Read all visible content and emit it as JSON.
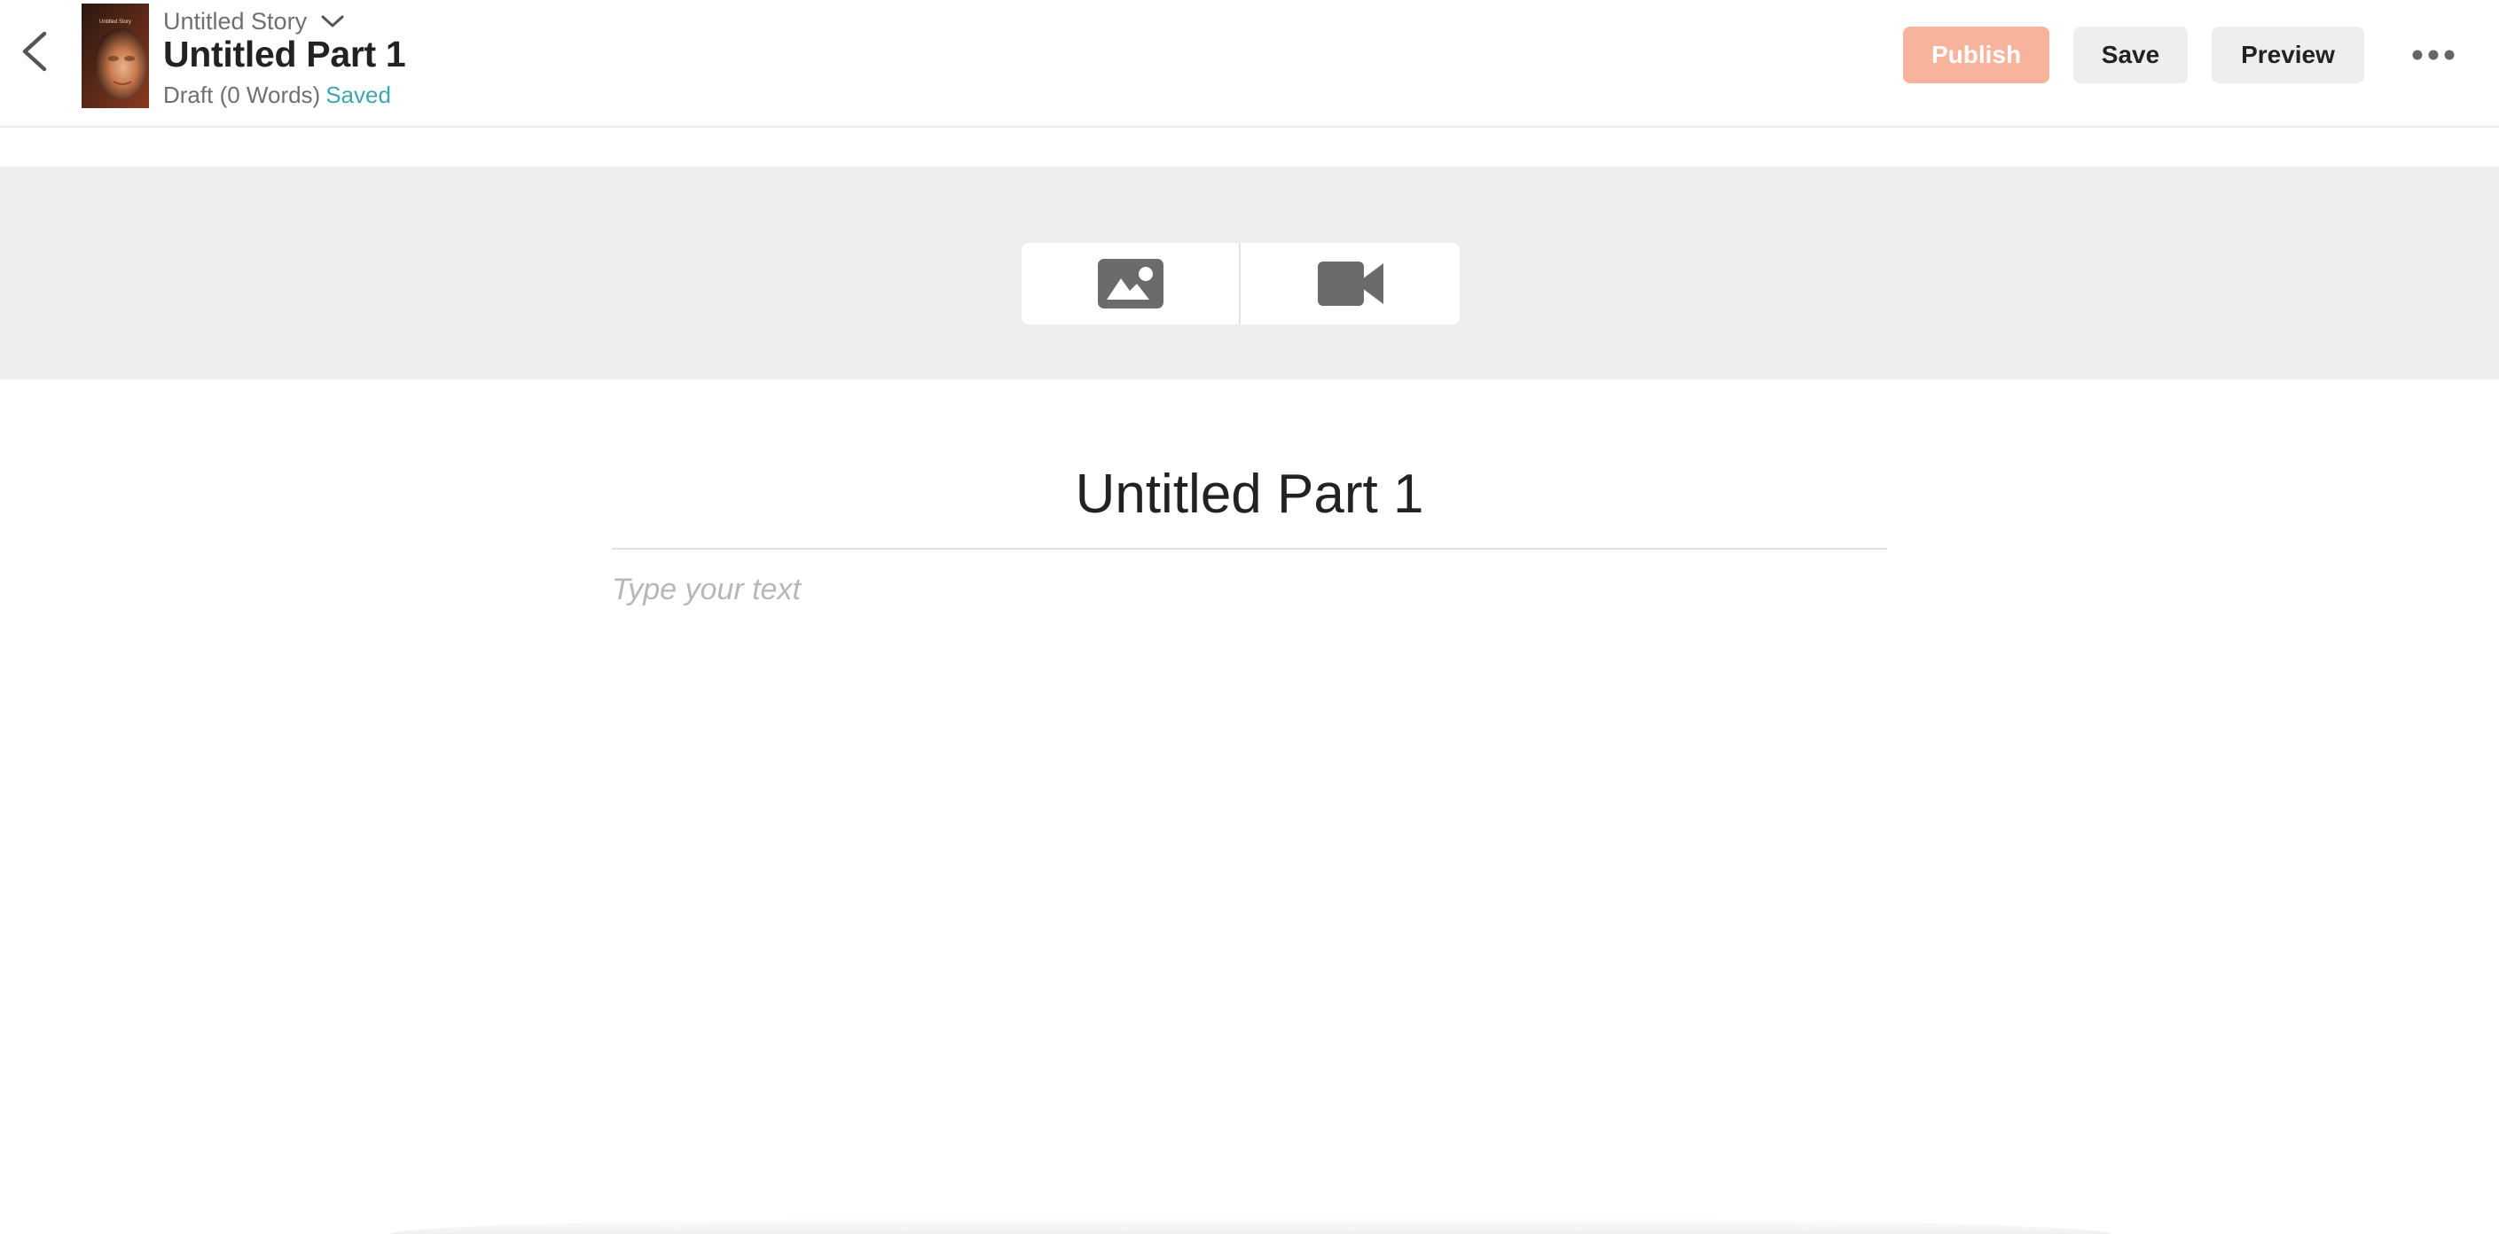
{
  "header": {
    "story_title": "Untitled Story",
    "part_title": "Untitled Part 1",
    "draft_status": "Draft (0 Words)",
    "save_status": "Saved",
    "cover_caption": "Untitled Story",
    "publish_label": "Publish",
    "save_label": "Save",
    "preview_label": "Preview",
    "icons": {
      "back": "chevron-left-icon",
      "story_dropdown": "chevron-down-icon",
      "more": "more-horizontal-icon"
    }
  },
  "media": {
    "icons": [
      "image-icon",
      "video-camera-icon"
    ]
  },
  "editor": {
    "heading": "Untitled Part 1",
    "body_placeholder": "Type your text"
  },
  "colors": {
    "publish_bg": "#f7b39c",
    "saved_text": "#3ca8ad",
    "banner_bg": "#eeeeee",
    "icon_gray": "#6b6b6b"
  }
}
